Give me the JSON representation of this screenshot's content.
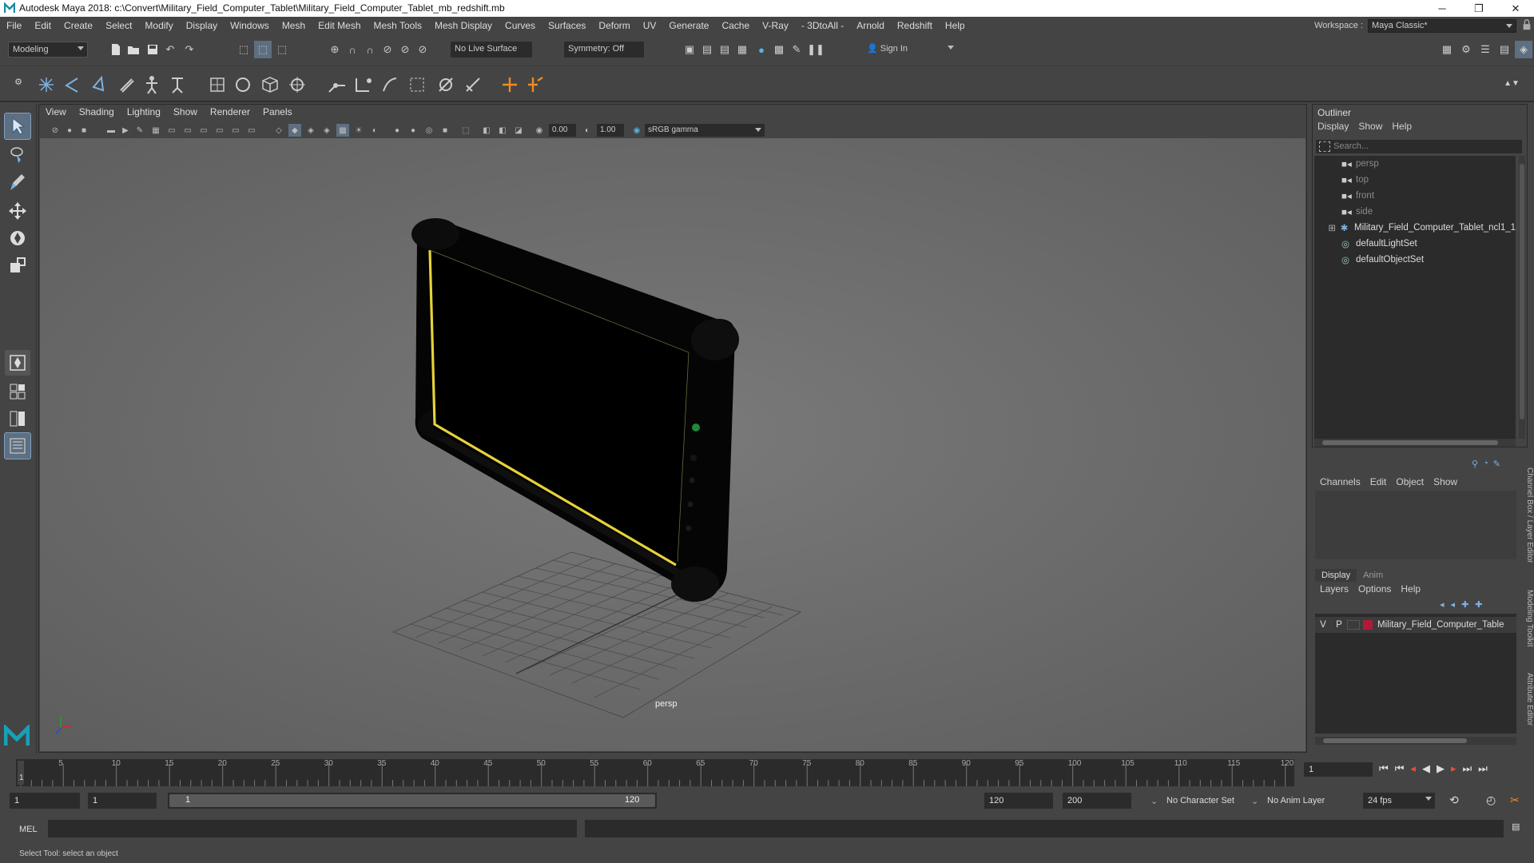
{
  "window": {
    "title": "Autodesk Maya 2018: c:\\Convert\\Military_Field_Computer_Tablet\\Military_Field_Computer_Tablet_mb_redshift.mb",
    "minimize": "─",
    "maximize": "❐",
    "close": "✕"
  },
  "menubar": {
    "items": [
      "File",
      "Edit",
      "Create",
      "Select",
      "Modify",
      "Display",
      "Windows",
      "Mesh",
      "Edit Mesh",
      "Mesh Tools",
      "Mesh Display",
      "Curves",
      "Surfaces",
      "Deform",
      "UV",
      "Generate",
      "Cache",
      "V-Ray",
      "- 3DtoAll -",
      "Arnold",
      "Redshift",
      "Help"
    ],
    "workspace_label": "Workspace :",
    "workspace_value": "Maya Classic*"
  },
  "statusline": {
    "mode": "Modeling",
    "live_surface": "No Live Surface",
    "symmetry": "Symmetry: Off",
    "sign_in": "Sign In"
  },
  "viewport": {
    "menus": [
      "View",
      "Shading",
      "Lighting",
      "Show",
      "Renderer",
      "Panels"
    ],
    "exposure": "0.00",
    "gamma": "1.00",
    "color_space": "sRGB gamma",
    "camera_label": "persp"
  },
  "outliner": {
    "title": "Outliner",
    "menus": [
      "Display",
      "Show",
      "Help"
    ],
    "search_placeholder": "Search...",
    "items": [
      {
        "label": "persp",
        "dim": true,
        "icon": "camera-icon"
      },
      {
        "label": "top",
        "dim": true,
        "icon": "camera-icon"
      },
      {
        "label": "front",
        "dim": true,
        "icon": "camera-icon"
      },
      {
        "label": "side",
        "dim": true,
        "icon": "camera-icon"
      },
      {
        "label": "Military_Field_Computer_Tablet_ncl1_1",
        "dim": false,
        "icon": "group-icon"
      },
      {
        "label": "defaultLightSet",
        "dim": false,
        "icon": "set-icon"
      },
      {
        "label": "defaultObjectSet",
        "dim": false,
        "icon": "set-icon"
      }
    ]
  },
  "channelbox": {
    "menus": [
      "Channels",
      "Edit",
      "Object",
      "Show"
    ],
    "tabs": [
      "Display",
      "Anim"
    ],
    "layer_menus": [
      "Layers",
      "Options",
      "Help"
    ],
    "layer": {
      "v": "V",
      "p": "P",
      "name": "Military_Field_Computer_Table",
      "color": "#b01a3a"
    },
    "side_tabs": [
      "Channel Box / Layer Editor",
      "Modeling Toolkit",
      "Attribute Editor"
    ]
  },
  "timeline": {
    "ticks": [
      "5",
      "10",
      "15",
      "20",
      "25",
      "30",
      "35",
      "40",
      "45",
      "50",
      "55",
      "60",
      "65",
      "70",
      "75",
      "80",
      "85",
      "90",
      "95",
      "100",
      "105",
      "110",
      "115",
      "120"
    ],
    "start_marker": "1",
    "current_frame": "1"
  },
  "range": {
    "start": "1",
    "playback_start": "1",
    "slider_start": "1",
    "slider_end": "120",
    "playback_end": "120",
    "end": "200",
    "character_set": "No Character Set",
    "anim_layer": "No Anim Layer",
    "fps": "24 fps"
  },
  "command": {
    "lang": "MEL"
  },
  "help_line": "Select Tool: select an object",
  "colors": {
    "accent": "#5d8fc4",
    "tablet_edge": "#e6d23a"
  }
}
